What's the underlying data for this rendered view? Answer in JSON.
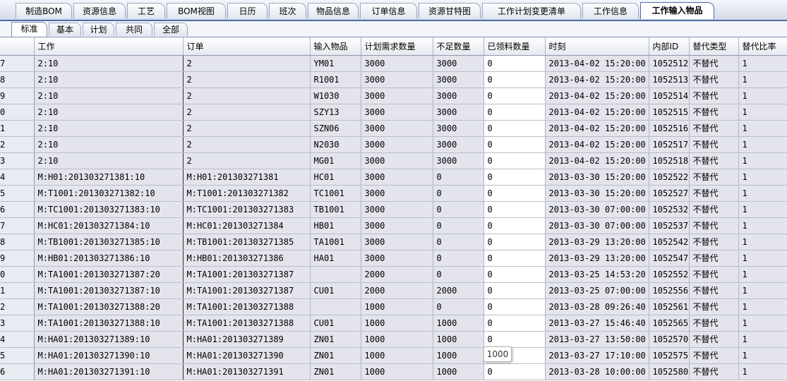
{
  "top_tabs": [
    {
      "label": "制造BOM",
      "active": false
    },
    {
      "label": "资源信息",
      "active": false
    },
    {
      "label": "工艺",
      "active": false
    },
    {
      "label": "BOM视图",
      "active": false
    },
    {
      "label": "日历",
      "active": false
    },
    {
      "label": "班次",
      "active": false
    },
    {
      "label": "物品信息",
      "active": false
    },
    {
      "label": "订单信息",
      "active": false
    },
    {
      "label": "资源甘特图",
      "active": false
    },
    {
      "label": "工作计划变更清单",
      "active": false
    },
    {
      "label": "工作信息",
      "active": false
    },
    {
      "label": "工作输入物品",
      "active": true
    }
  ],
  "sub_tabs": [
    {
      "label": "标准",
      "active": true
    },
    {
      "label": "基本",
      "active": false
    },
    {
      "label": "计划",
      "active": false
    },
    {
      "label": "共同",
      "active": false
    },
    {
      "label": "全部",
      "active": false
    }
  ],
  "columns": [
    "工作",
    "订单",
    "输入物品",
    "计划需求数量",
    "不足数量",
    "已领料数量",
    "时刻",
    "内部ID",
    "替代类型",
    "替代比率"
  ],
  "rows": [
    {
      "n": "7",
      "job": "2:10",
      "order": "2",
      "item": "YM01",
      "plan": "3000",
      "short": "3000",
      "issued": "0",
      "time": "2013-04-02 15:20:00",
      "id": "1052512",
      "type": "不替代",
      "ratio": "1"
    },
    {
      "n": "8",
      "job": "2:10",
      "order": "2",
      "item": "R1001",
      "plan": "3000",
      "short": "3000",
      "issued": "0",
      "time": "2013-04-02 15:20:00",
      "id": "1052513",
      "type": "不替代",
      "ratio": "1"
    },
    {
      "n": "9",
      "job": "2:10",
      "order": "2",
      "item": "W1030",
      "plan": "3000",
      "short": "3000",
      "issued": "0",
      "time": "2013-04-02 15:20:00",
      "id": "1052514",
      "type": "不替代",
      "ratio": "1"
    },
    {
      "n": "0",
      "job": "2:10",
      "order": "2",
      "item": "SZY13",
      "plan": "3000",
      "short": "3000",
      "issued": "0",
      "time": "2013-04-02 15:20:00",
      "id": "1052515",
      "type": "不替代",
      "ratio": "1"
    },
    {
      "n": "1",
      "job": "2:10",
      "order": "2",
      "item": "SZN06",
      "plan": "3000",
      "short": "3000",
      "issued": "0",
      "time": "2013-04-02 15:20:00",
      "id": "1052516",
      "type": "不替代",
      "ratio": "1"
    },
    {
      "n": "2",
      "job": "2:10",
      "order": "2",
      "item": "N2030",
      "plan": "3000",
      "short": "3000",
      "issued": "0",
      "time": "2013-04-02 15:20:00",
      "id": "1052517",
      "type": "不替代",
      "ratio": "1"
    },
    {
      "n": "3",
      "job": "2:10",
      "order": "2",
      "item": "MG01",
      "plan": "3000",
      "short": "3000",
      "issued": "0",
      "time": "2013-04-02 15:20:00",
      "id": "1052518",
      "type": "不替代",
      "ratio": "1"
    },
    {
      "n": "4",
      "job": "M:H01:201303271381:10",
      "order": "M:H01:201303271381",
      "item": "HC01",
      "plan": "3000",
      "short": "0",
      "issued": "0",
      "time": "2013-03-30 15:20:00",
      "id": "1052522",
      "type": "不替代",
      "ratio": "1"
    },
    {
      "n": "5",
      "job": "M:T1001:201303271382:10",
      "order": "M:T1001:201303271382",
      "item": "TC1001",
      "plan": "3000",
      "short": "0",
      "issued": "0",
      "time": "2013-03-30 15:20:00",
      "id": "1052527",
      "type": "不替代",
      "ratio": "1"
    },
    {
      "n": "6",
      "job": "M:TC1001:201303271383:10",
      "order": "M:TC1001:201303271383",
      "item": "TB1001",
      "plan": "3000",
      "short": "0",
      "issued": "0",
      "time": "2013-03-30 07:00:00",
      "id": "1052532",
      "type": "不替代",
      "ratio": "1"
    },
    {
      "n": "7",
      "job": "M:HC01:201303271384:10",
      "order": "M:HC01:201303271384",
      "item": "HB01",
      "plan": "3000",
      "short": "0",
      "issued": "0",
      "time": "2013-03-30 07:00:00",
      "id": "1052537",
      "type": "不替代",
      "ratio": "1"
    },
    {
      "n": "8",
      "job": "M:TB1001:201303271385:10",
      "order": "M:TB1001:201303271385",
      "item": "TA1001",
      "plan": "3000",
      "short": "0",
      "issued": "0",
      "time": "2013-03-29 13:20:00",
      "id": "1052542",
      "type": "不替代",
      "ratio": "1"
    },
    {
      "n": "9",
      "job": "M:HB01:201303271386:10",
      "order": "M:HB01:201303271386",
      "item": "HA01",
      "plan": "3000",
      "short": "0",
      "issued": "0",
      "time": "2013-03-29 13:20:00",
      "id": "1052547",
      "type": "不替代",
      "ratio": "1"
    },
    {
      "n": "0",
      "job": "M:TA1001:201303271387:20",
      "order": "M:TA1001:201303271387",
      "item": "",
      "plan": "2000",
      "short": "0",
      "issued": "0",
      "time": "2013-03-25 14:53:20",
      "id": "1052552",
      "type": "不替代",
      "ratio": "1"
    },
    {
      "n": "1",
      "job": "M:TA1001:201303271387:10",
      "order": "M:TA1001:201303271387",
      "item": "CU01",
      "plan": "2000",
      "short": "2000",
      "issued": "0",
      "time": "2013-03-25 07:00:00",
      "id": "1052556",
      "type": "不替代",
      "ratio": "1"
    },
    {
      "n": "2",
      "job": "M:TA1001:201303271388:20",
      "order": "M:TA1001:201303271388",
      "item": "",
      "plan": "1000",
      "short": "0",
      "issued": "0",
      "time": "2013-03-28 09:26:40",
      "id": "1052561",
      "type": "不替代",
      "ratio": "1"
    },
    {
      "n": "3",
      "job": "M:TA1001:201303271388:10",
      "order": "M:TA1001:201303271388",
      "item": "CU01",
      "plan": "1000",
      "short": "1000",
      "issued": "0",
      "time": "2013-03-27 15:46:40",
      "id": "1052565",
      "type": "不替代",
      "ratio": "1"
    },
    {
      "n": "4",
      "job": "M:HA01:201303271389:10",
      "order": "M:HA01:201303271389",
      "item": "ZN01",
      "plan": "1000",
      "short": "1000",
      "issued": "0",
      "time": "2013-03-27 13:50:00",
      "id": "1052570",
      "type": "不替代",
      "ratio": "1"
    },
    {
      "n": "5",
      "job": "M:HA01:201303271390:10",
      "order": "M:HA01:201303271390",
      "item": "ZN01",
      "plan": "1000",
      "short": "1000",
      "issued": "",
      "time": "2013-03-27 17:10:00",
      "id": "1052575",
      "type": "不替代",
      "ratio": "1"
    },
    {
      "n": "6",
      "job": "M:HA01:201303271391:10",
      "order": "M:HA01:201303271391",
      "item": "ZN01",
      "plan": "1000",
      "short": "1000",
      "issued": "0",
      "time": "2013-03-28 10:00:00",
      "id": "1052580",
      "type": "不替代",
      "ratio": "1"
    }
  ],
  "tooltip": "1000"
}
